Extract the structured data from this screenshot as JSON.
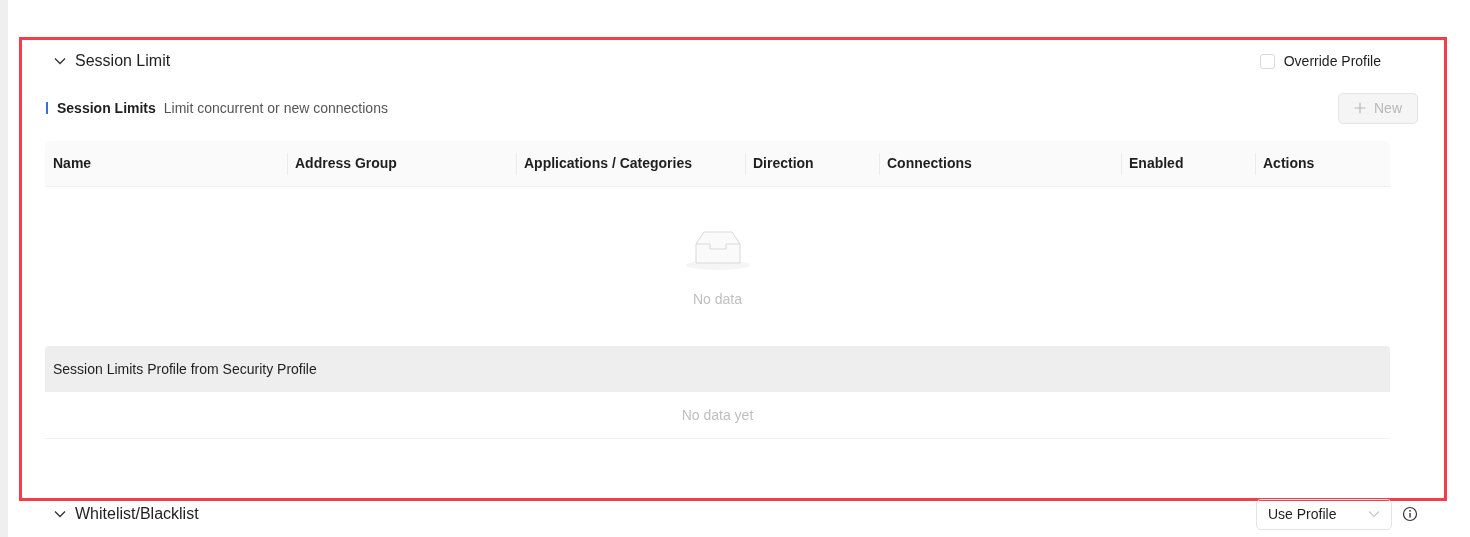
{
  "highlighted": true,
  "session_limit": {
    "title": "Session Limit",
    "expanded": true,
    "override_profile": {
      "label": "Override Profile",
      "checked": false
    },
    "subheader": {
      "title": "Session Limits",
      "description": "Limit concurrent or new connections"
    },
    "new_button": {
      "label": "New",
      "disabled": true
    },
    "table": {
      "columns": [
        "Name",
        "Address Group",
        "Applications / Categories",
        "Direction",
        "Connections",
        "Enabled",
        "Actions"
      ],
      "empty_text": "No data"
    },
    "profile_table": {
      "title": "Session Limits Profile from Security Profile",
      "empty_text": "No data yet"
    }
  },
  "whitelist": {
    "title": "Whitelist/Blacklist",
    "expanded": true,
    "select": {
      "value": "Use Profile"
    }
  }
}
